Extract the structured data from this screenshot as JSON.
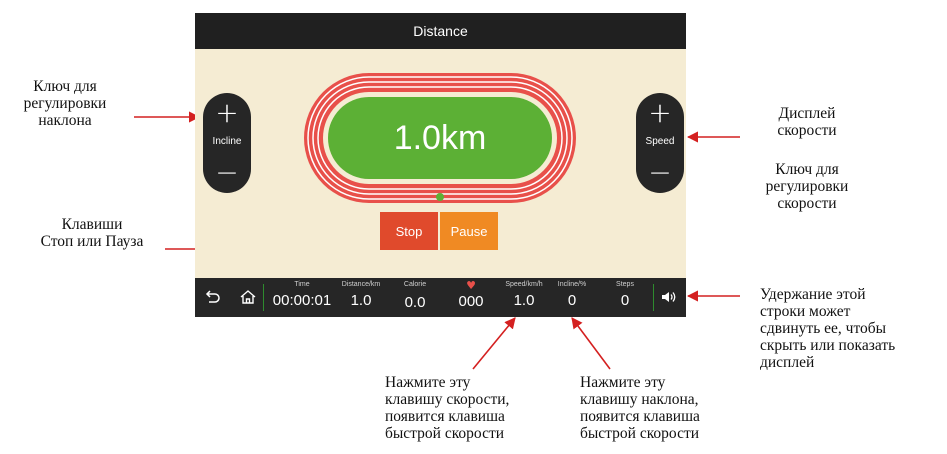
{
  "screen": {
    "title": "Distance",
    "incline_control": {
      "plus": "+",
      "label": "Incline",
      "minus": "−"
    },
    "speed_control": {
      "plus": "+",
      "label": "Speed",
      "minus": "−"
    },
    "display_value": "1.0km",
    "buttons": {
      "stop": "Stop",
      "pause": "Pause"
    },
    "colors": {
      "accent_red": "#e04a2c",
      "accent_orange": "#f08a23",
      "track_green": "#5cb035",
      "track_red": "#e8504a"
    },
    "bottom_bar": {
      "icons": [
        "back-icon",
        "home-icon",
        "volume-icon"
      ],
      "stats": [
        {
          "label": "Time",
          "value": "00:00:01"
        },
        {
          "label": "Distance/km",
          "value": "1.0"
        },
        {
          "label": "Calorie",
          "value": "0.0"
        },
        {
          "label": "",
          "value": "000"
        },
        {
          "label": "Speed/km/h",
          "value": "1.0"
        },
        {
          "label": "Incline/%",
          "value": "0"
        },
        {
          "label": "Steps",
          "value": "0"
        }
      ]
    }
  },
  "annotations": {
    "incline_key": [
      "Ключ для",
      "регулировки",
      "наклона"
    ],
    "speed_display": [
      "Дисплей",
      "скорости"
    ],
    "speed_key": [
      "Ключ для",
      "регулировки",
      "скорости"
    ],
    "stop_pause": [
      "Клавиши",
      "Стоп или Пауза"
    ],
    "hold_bar": [
      "Удержание этой",
      "строки может",
      "сдвинуть ее, чтобы",
      "скрыть или показать",
      "дисплей"
    ],
    "speed_quick": [
      "Нажмите эту",
      "клавишу скорости,",
      "появится клавиша",
      "быстрой скорости"
    ],
    "incline_quick": [
      "Нажмите эту",
      "клавишу наклона,",
      "появится клавиша",
      "быстрой скорости"
    ]
  }
}
